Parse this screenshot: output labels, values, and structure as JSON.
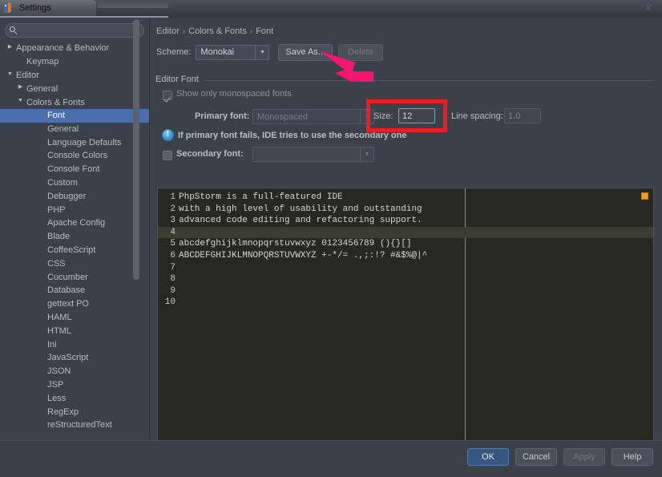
{
  "window": {
    "title": "Settings",
    "app_icon": "phpstorm-icon",
    "close_icon": "close-icon"
  },
  "sidebar": {
    "search": {
      "value": "",
      "placeholder": "",
      "icon": "search-icon"
    },
    "items": [
      {
        "label": "Appearance & Behavior",
        "indent": 0,
        "twisty": "collapsed",
        "selected": false
      },
      {
        "label": "Keymap",
        "indent": 1,
        "twisty": "none",
        "selected": false
      },
      {
        "label": "Editor",
        "indent": 0,
        "twisty": "expanded",
        "selected": false
      },
      {
        "label": "General",
        "indent": 1,
        "twisty": "collapsed",
        "selected": false
      },
      {
        "label": "Colors & Fonts",
        "indent": 1,
        "twisty": "expanded",
        "selected": false
      },
      {
        "label": "Font",
        "indent": 3,
        "twisty": "none",
        "selected": true
      },
      {
        "label": "General",
        "indent": 3,
        "twisty": "none",
        "selected": false
      },
      {
        "label": "Language Defaults",
        "indent": 3,
        "twisty": "none",
        "selected": false
      },
      {
        "label": "Console Colors",
        "indent": 3,
        "twisty": "none",
        "selected": false
      },
      {
        "label": "Console Font",
        "indent": 3,
        "twisty": "none",
        "selected": false
      },
      {
        "label": "Custom",
        "indent": 3,
        "twisty": "none",
        "selected": false
      },
      {
        "label": "Debugger",
        "indent": 3,
        "twisty": "none",
        "selected": false
      },
      {
        "label": "PHP",
        "indent": 3,
        "twisty": "none",
        "selected": false
      },
      {
        "label": "Apache Config",
        "indent": 3,
        "twisty": "none",
        "selected": false
      },
      {
        "label": "Blade",
        "indent": 3,
        "twisty": "none",
        "selected": false
      },
      {
        "label": "CoffeeScript",
        "indent": 3,
        "twisty": "none",
        "selected": false
      },
      {
        "label": "CSS",
        "indent": 3,
        "twisty": "none",
        "selected": false
      },
      {
        "label": "Cucumber",
        "indent": 3,
        "twisty": "none",
        "selected": false
      },
      {
        "label": "Database",
        "indent": 3,
        "twisty": "none",
        "selected": false
      },
      {
        "label": "gettext PO",
        "indent": 3,
        "twisty": "none",
        "selected": false
      },
      {
        "label": "HAML",
        "indent": 3,
        "twisty": "none",
        "selected": false
      },
      {
        "label": "HTML",
        "indent": 3,
        "twisty": "none",
        "selected": false
      },
      {
        "label": "Ini",
        "indent": 3,
        "twisty": "none",
        "selected": false
      },
      {
        "label": "JavaScript",
        "indent": 3,
        "twisty": "none",
        "selected": false
      },
      {
        "label": "JSON",
        "indent": 3,
        "twisty": "none",
        "selected": false
      },
      {
        "label": "JSP",
        "indent": 3,
        "twisty": "none",
        "selected": false
      },
      {
        "label": "Less",
        "indent": 3,
        "twisty": "none",
        "selected": false
      },
      {
        "label": "RegExp",
        "indent": 3,
        "twisty": "none",
        "selected": false
      },
      {
        "label": "reStructuredText",
        "indent": 3,
        "twisty": "none",
        "selected": false
      }
    ]
  },
  "main": {
    "breadcrumb": [
      "Editor",
      "Colors & Fonts",
      "Font"
    ],
    "scheme": {
      "label": "Scheme:",
      "value": "Monokai",
      "save_as_label": "Save As...",
      "delete_label": "Delete"
    },
    "group": {
      "title": "Editor Font",
      "monospaced_checkbox": {
        "label": "Show only monospaced fonts",
        "checked": true
      },
      "primary_font": {
        "label": "Primary font:",
        "value": "Monospaced"
      },
      "size": {
        "label": "Size:",
        "value": "12"
      },
      "line_spacing": {
        "label": "Line spacing:",
        "value": "1.0"
      },
      "info": {
        "icon": "info-icon",
        "text": "If primary font fails, IDE tries to use the secondary one"
      },
      "secondary_font": {
        "label": "Secondary font:",
        "value": "",
        "checked": false
      }
    },
    "preview": {
      "marker_color": "#f0a01e",
      "caret_line": 4,
      "lines": [
        {
          "num": "1",
          "text": "PhpStorm is a full-featured IDE"
        },
        {
          "num": "2",
          "text": "with a high level of usability and outstanding"
        },
        {
          "num": "3",
          "text": "advanced code editing and refactoring support."
        },
        {
          "num": "4",
          "text": ""
        },
        {
          "num": "5",
          "text": "abcdefghijklmnopqrstuvwxyz 0123456789 (){}[]"
        },
        {
          "num": "6",
          "text": "ABCDEFGHIJKLMNOPQRSTUVWXYZ +-*/= .,;:!? #&$%@|^"
        },
        {
          "num": "7",
          "text": ""
        },
        {
          "num": "8",
          "text": ""
        },
        {
          "num": "9",
          "text": ""
        },
        {
          "num": "10",
          "text": ""
        }
      ]
    }
  },
  "footer": {
    "ok": "OK",
    "cancel": "Cancel",
    "apply": "Apply",
    "help": "Help"
  },
  "annotations": {
    "red_box_color": "#ee1c24",
    "arrow_color": "#f5166f"
  }
}
